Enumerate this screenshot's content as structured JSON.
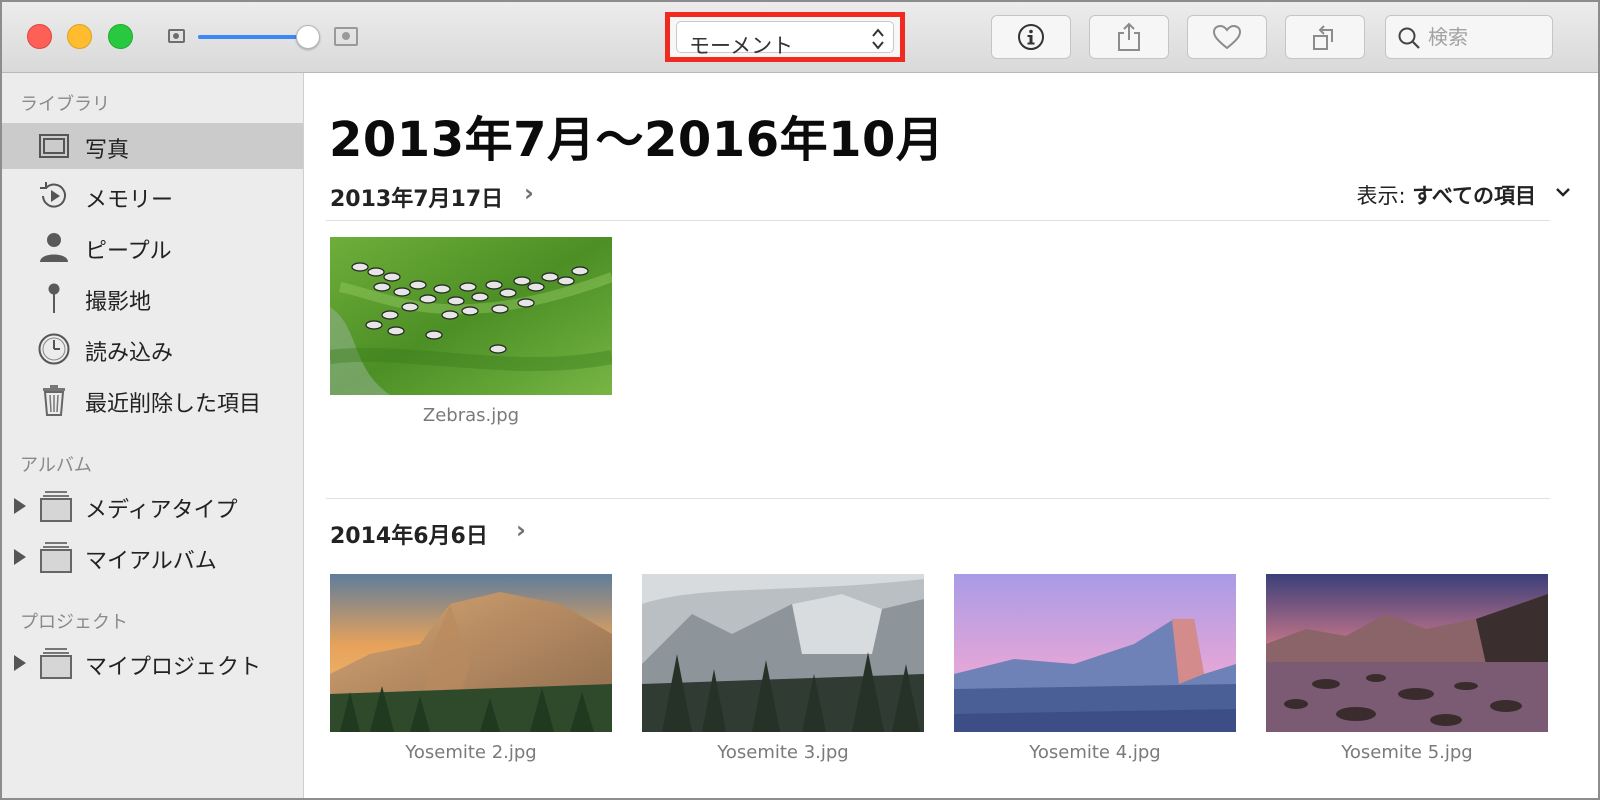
{
  "toolbar": {
    "view_select": "モーメント",
    "search_placeholder": "検索",
    "zoom_level": 0.9,
    "buttons": [
      "info-icon",
      "share-icon",
      "heart-icon",
      "rotate-icon"
    ]
  },
  "sidebar": {
    "library_header": "ライブラリ",
    "library_items": [
      {
        "label": "写真",
        "icon": "photos-icon",
        "selected": true
      },
      {
        "label": "メモリー",
        "icon": "memories-icon"
      },
      {
        "label": "ピープル",
        "icon": "person-icon"
      },
      {
        "label": "撮影地",
        "icon": "pin-icon"
      },
      {
        "label": "読み込み",
        "icon": "clock-icon"
      },
      {
        "label": "最近削除した項目",
        "icon": "trash-icon"
      }
    ],
    "album_header": "アルバム",
    "album_items": [
      {
        "label": "メディアタイプ",
        "icon": "album-stack-icon"
      },
      {
        "label": "マイアルバム",
        "icon": "album-stack-icon"
      }
    ],
    "project_header": "プロジェクト",
    "project_items": [
      {
        "label": "マイプロジェクト",
        "icon": "album-stack-icon"
      }
    ]
  },
  "main": {
    "range_title": "2013年7月〜2016年10月",
    "show_prefix": "表示:",
    "show_value": "すべての項目",
    "moments": [
      {
        "date": "2013年7月17日",
        "photos": [
          {
            "name": "Zebras.jpg"
          }
        ]
      },
      {
        "date": "2014年6月6日",
        "photos": [
          {
            "name": "Yosemite 2.jpg"
          },
          {
            "name": "Yosemite 3.jpg"
          },
          {
            "name": "Yosemite 4.jpg"
          },
          {
            "name": "Yosemite 5.jpg"
          }
        ]
      }
    ]
  },
  "colors": {
    "highlight_border": "#f02a1f",
    "accent_blue": "#3b88f5",
    "sidebar_bg": "#ececec",
    "selected_bg": "#cbcbcb"
  }
}
